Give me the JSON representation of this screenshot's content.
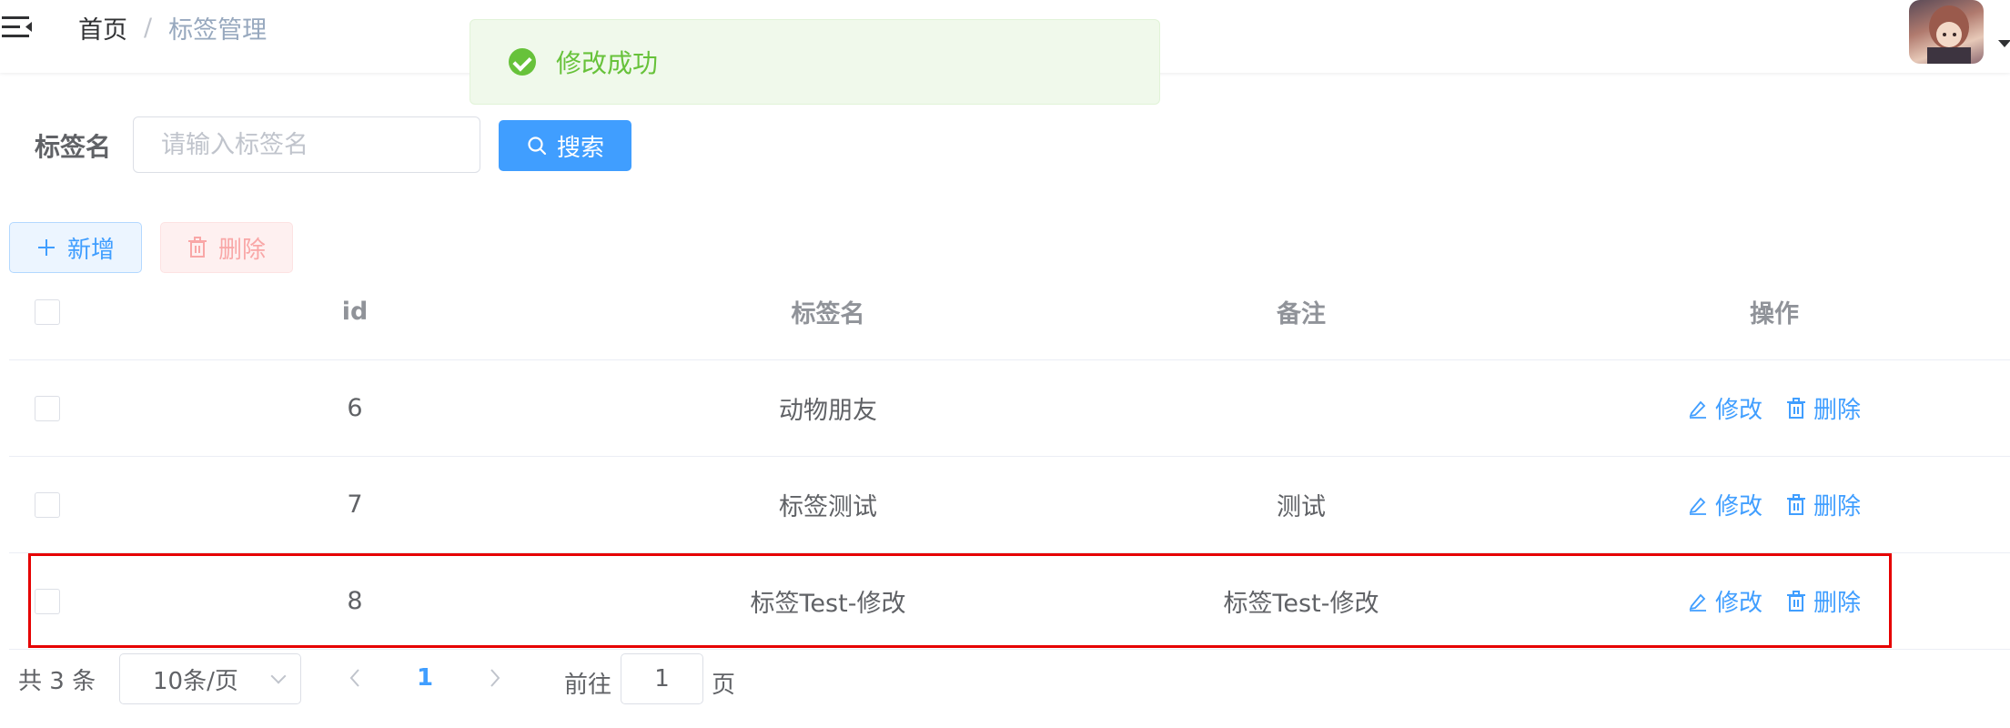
{
  "header": {
    "breadcrumb_home": "首页",
    "breadcrumb_separator": "/",
    "breadcrumb_current": "标签管理"
  },
  "toast": {
    "message": "修改成功",
    "type": "success",
    "color": "#67c23a"
  },
  "search": {
    "label": "标签名",
    "placeholder": "请输入标签名",
    "value": "",
    "button_label": "搜索"
  },
  "toolbar": {
    "add_label": "新增",
    "delete_label": "删除"
  },
  "table": {
    "columns": [
      "id",
      "标签名",
      "备注",
      "操作"
    ],
    "rows": [
      {
        "id": "6",
        "name": "动物朋友",
        "note": "",
        "edit": "修改",
        "delete": "删除"
      },
      {
        "id": "7",
        "name": "标签测试",
        "note": "测试",
        "edit": "修改",
        "delete": "删除"
      },
      {
        "id": "8",
        "name": "标签Test-修改",
        "note": "标签Test-修改",
        "edit": "修改",
        "delete": "删除"
      }
    ]
  },
  "pagination": {
    "total_text": "共 3 条",
    "page_size": "10条/页",
    "current_page": "1",
    "goto_label": "前往",
    "goto_value": "1",
    "page_suffix": "页"
  },
  "colors": {
    "primary": "#409eff",
    "success": "#67c23a",
    "danger_light": "#f9a7a7",
    "highlight": "#e60000"
  }
}
